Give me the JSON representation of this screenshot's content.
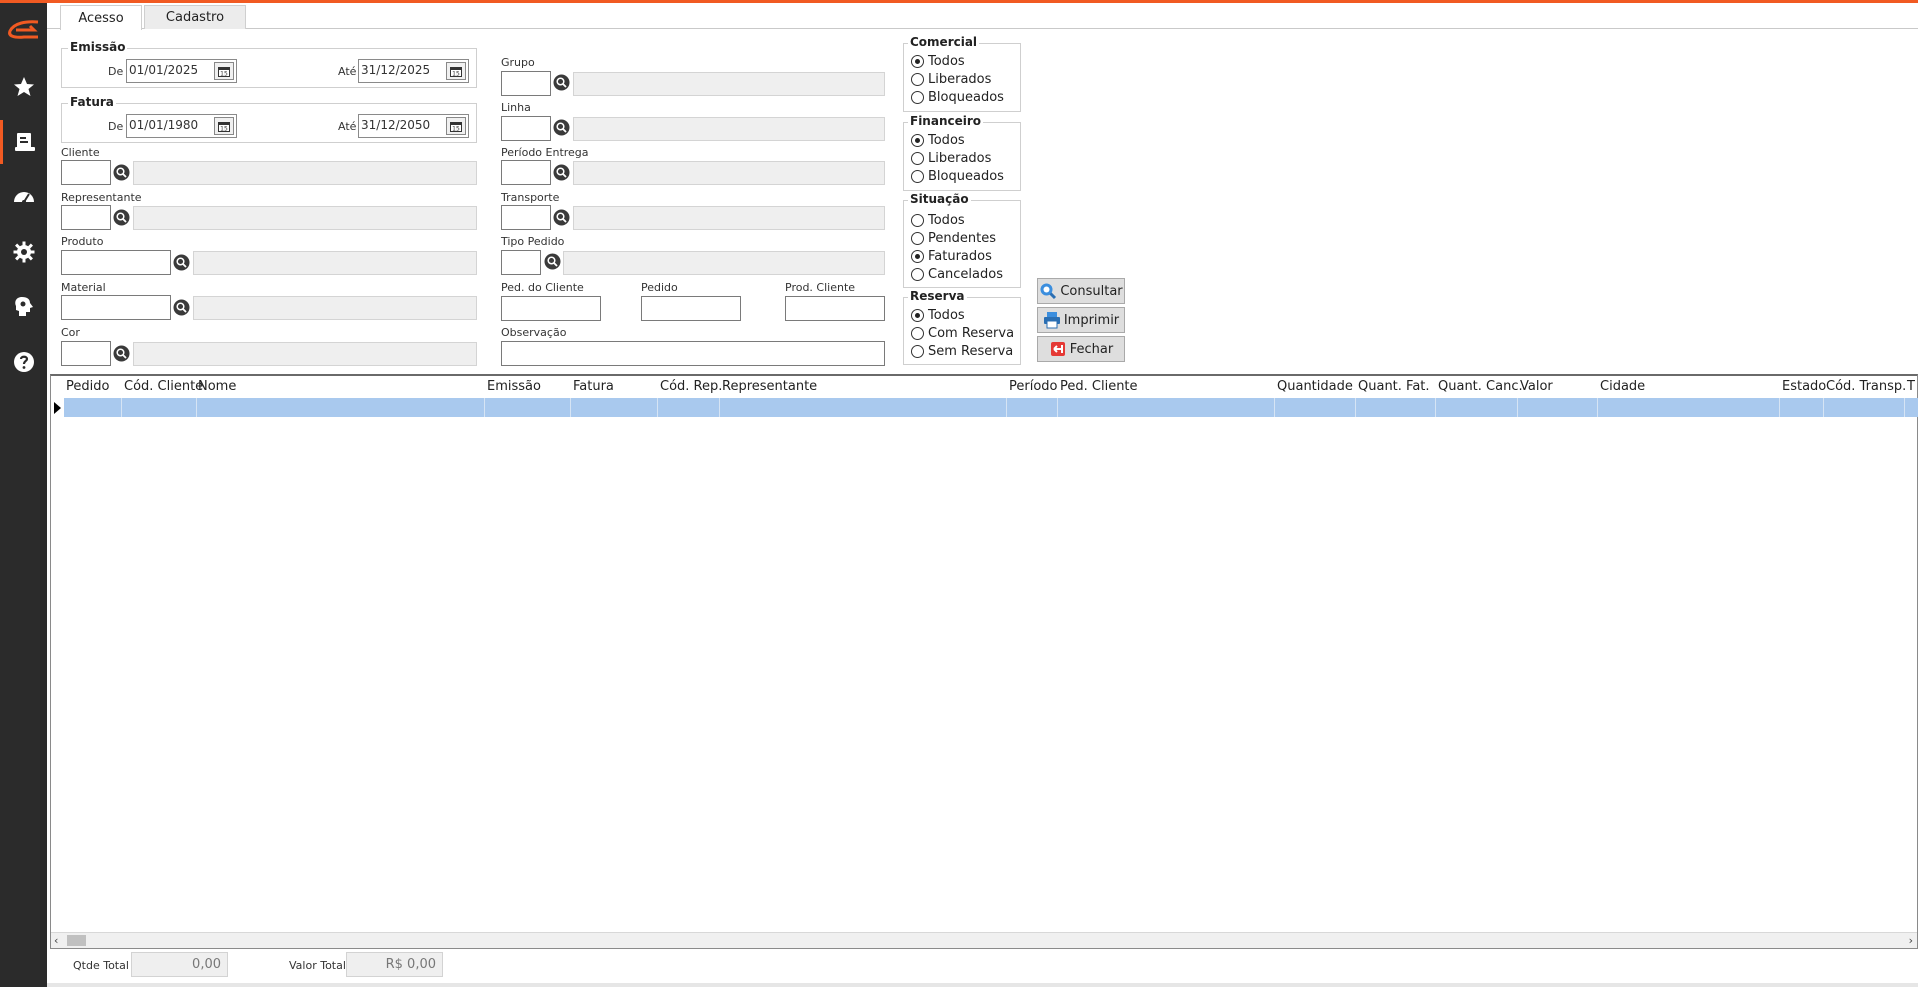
{
  "tabs": [
    "Acesso",
    "Cadastro"
  ],
  "emissao": {
    "title": "Emissão",
    "de_label": "De",
    "de": "01/01/2025",
    "ate_label": "Até",
    "ate": "31/12/2025"
  },
  "fatura": {
    "title": "Fatura",
    "de_label": "De",
    "de": "01/01/1980",
    "ate_label": "Até",
    "ate": "31/12/2050"
  },
  "labels": {
    "cliente": "Cliente",
    "representante": "Representante",
    "produto": "Produto",
    "material": "Material",
    "cor": "Cor",
    "grupo": "Grupo",
    "linha": "Linha",
    "periodo_entrega": "Período Entrega",
    "transporte": "Transporte",
    "tipo_pedido": "Tipo Pedido",
    "ped_cliente": "Ped. do Cliente",
    "pedido": "Pedido",
    "prod_cliente": "Prod. Cliente",
    "observacao": "Observação"
  },
  "comercial": {
    "title": "Comercial",
    "options": [
      "Todos",
      "Liberados",
      "Bloqueados"
    ],
    "selected": "Todos"
  },
  "financeiro": {
    "title": "Financeiro",
    "options": [
      "Todos",
      "Liberados",
      "Bloqueados"
    ],
    "selected": "Todos"
  },
  "situacao": {
    "title": "Situação",
    "options": [
      "Todos",
      "Pendentes",
      "Faturados",
      "Cancelados"
    ],
    "selected": "Faturados"
  },
  "reserva": {
    "title": "Reserva",
    "options": [
      "Todos",
      "Com Reserva",
      "Sem Reserva"
    ],
    "selected": "Todos"
  },
  "buttons": {
    "consultar": "Consultar",
    "imprimir": "Imprimir",
    "fechar": "Fechar"
  },
  "grid": {
    "columns": [
      "Pedido",
      "Cód. Cliente",
      "Nome",
      "Emissão",
      "Fatura",
      "Cód. Rep.",
      "Representante",
      "Período",
      "Ped. Cliente",
      "Quantidade",
      "Quant. Fat.",
      "Quant. Canc.",
      "Valor",
      "Cidade",
      "Estado",
      "Cód. Transp.",
      "T"
    ]
  },
  "footer": {
    "qtde_label": "Qtde Total",
    "qtde_value": "0,00",
    "valor_label": "Valor Total",
    "valor_value": "R$ 0,00"
  },
  "colors": {
    "accent": "#f15a22",
    "sidebar": "#2b2b2b",
    "selected_row": "#a9c9ee"
  },
  "icons": [
    "logo-icon",
    "star-icon",
    "report-icon",
    "dashboard-icon",
    "gear-icon",
    "brain-icon",
    "help-icon",
    "search-icon",
    "calendar-icon",
    "print-icon",
    "exit-icon"
  ]
}
